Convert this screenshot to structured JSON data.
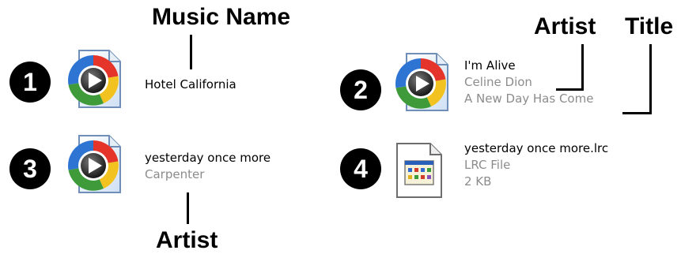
{
  "callouts": {
    "music_name": "Music Name",
    "artist_top": "Artist",
    "title": "Title",
    "artist_bottom": "Artist"
  },
  "items": [
    {
      "number": "1",
      "icon": "media-player-file-icon",
      "lines": [
        "Hotel California"
      ]
    },
    {
      "number": "2",
      "icon": "media-player-file-icon",
      "lines": [
        "I'm Alive",
        "Celine Dion",
        "A New Day Has Come"
      ]
    },
    {
      "number": "3",
      "icon": "media-player-file-icon",
      "lines": [
        "yesterday once more",
        "Carpenter"
      ]
    },
    {
      "number": "4",
      "icon": "lrc-text-file-icon",
      "lines": [
        "yesterday once more.lrc",
        "LRC File",
        "2 KB"
      ]
    }
  ],
  "colors": {
    "primary_text": "#000000",
    "secondary_text": "#8c8c8c",
    "badge_fill": "#000000",
    "badge_text": "#ffffff"
  }
}
